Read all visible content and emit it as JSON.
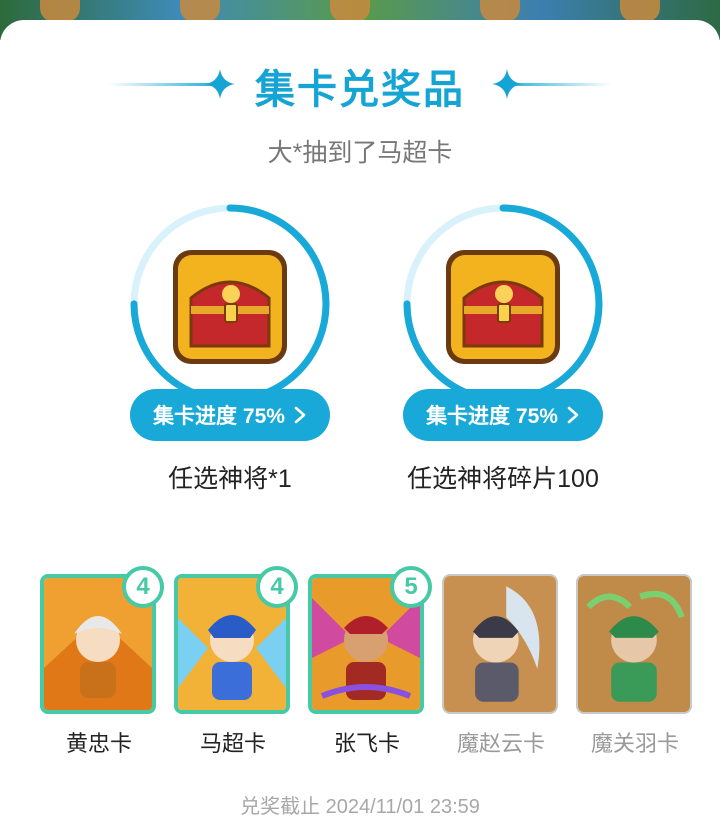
{
  "header": {
    "title": "集卡兑奖品",
    "subtitle": "大*抽到了马超卡"
  },
  "rewards": [
    {
      "progress_label": "集卡进度 75%",
      "progress": 0.75,
      "name": "任选神将*1",
      "icon": "treasure-chest-icon"
    },
    {
      "progress_label": "集卡进度 75%",
      "progress": 0.75,
      "name": "任选神将碎片100",
      "icon": "treasure-chest-icon"
    }
  ],
  "cards": [
    {
      "name": "黄忠卡",
      "count": "4",
      "owned": true
    },
    {
      "name": "马超卡",
      "count": "4",
      "owned": true
    },
    {
      "name": "张飞卡",
      "count": "5",
      "owned": true
    },
    {
      "name": "魔赵云卡",
      "count": "",
      "owned": false
    },
    {
      "name": "魔关羽卡",
      "count": "",
      "owned": false
    }
  ],
  "footer": {
    "deadline": "兑奖截止 2024/11/01 23:59"
  },
  "colors": {
    "accent": "#18a9d8",
    "owned_border": "#46c9a5",
    "locked_text": "#9a9a9a"
  }
}
